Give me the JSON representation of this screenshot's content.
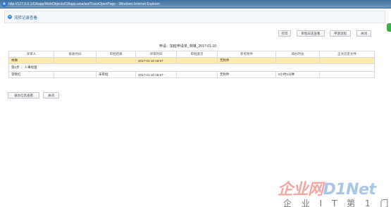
{
  "window": {
    "title": "http://127.0.0.1/OAapp/WebObjects/OAapp.woa/wa/TraceOpenPage - Windows Internet Explorer",
    "browser_icon": "e"
  },
  "panel": {
    "title": "流转记录查看",
    "icon": "+"
  },
  "toolbar": {
    "print": "打印",
    "system_log": "审批日志查看",
    "process": "申请流程",
    "close": "关闭"
  },
  "form_title": "申请：加班申请单_林琳_2017-01-10",
  "table": {
    "headers": [
      "评审人",
      "接收时间",
      "审批结果",
      "评审时间",
      "审批意见",
      "参考附件",
      "阅办时长",
      "正文历史文件"
    ],
    "rows": [
      {
        "type": "highlight",
        "cells": [
          "林琳",
          "",
          "",
          "2017-01-10 18:57",
          "",
          "无附件",
          "",
          ""
        ]
      },
      {
        "type": "step",
        "cells": [
          "第1步 ｜ 人事经理"
        ]
      },
      {
        "type": "normal",
        "cells": [
          "李晓红",
          "",
          "未审批",
          "2017-01-10 18:57 -",
          "",
          "无附件",
          "0小时1分钟",
          ""
        ]
      }
    ]
  },
  "bottom": {
    "record_view": "录办信息查看",
    "close": "关闭"
  },
  "watermark": {
    "main": "企业网",
    "main2": "D1Net",
    "sub": "企 业 I T 第 1 门 户"
  }
}
